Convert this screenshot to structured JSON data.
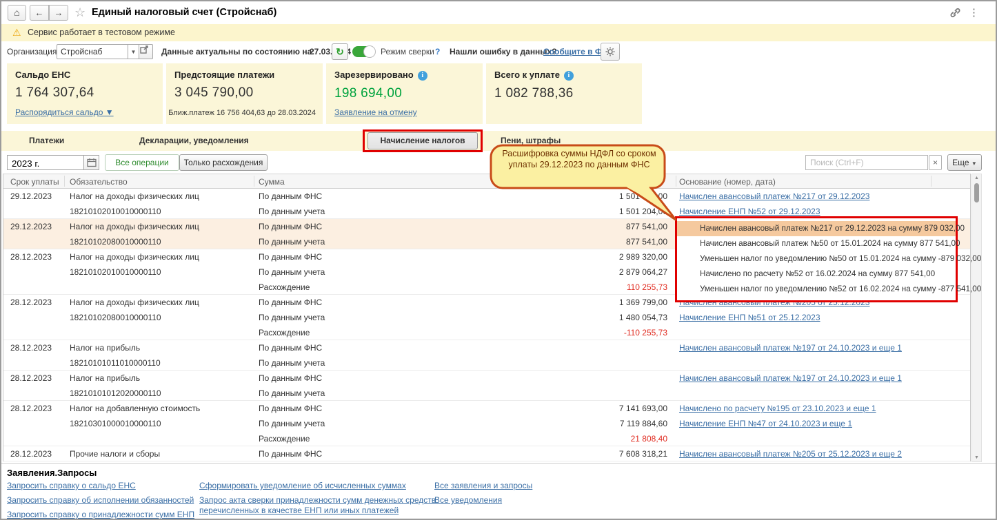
{
  "window": {
    "title": "Единый налоговый счет (Стройснаб)"
  },
  "banner": {
    "text": "Сервис работает в тестовом режиме"
  },
  "toolbar": {
    "org_label": "Организация:",
    "org_value": "Стройснаб",
    "actual_label": "Данные актуальны по состоянию на:",
    "actual_date": "27.03.2024",
    "mode_label": "Режим сверки",
    "mode_help": "?",
    "error_question": "Нашли ошибку в данных?",
    "error_link": "Сообщите в ФНС"
  },
  "cards": [
    {
      "title": "Сальдо ЕНС",
      "value": "1 764 307,64",
      "link": "Распорядиться сальдо ▼"
    },
    {
      "title": "Предстоящие платежи",
      "value": "3 045 790,00",
      "note": "Ближ.платеж 16 756 404,63 до 28.03.2024"
    },
    {
      "title": "Зарезервировано",
      "value": "198 694,00",
      "link": "Заявление на отмену"
    },
    {
      "title": "Всего к уплате",
      "value": "1 082 788,36"
    }
  ],
  "tabs": [
    {
      "label": "Платежи"
    },
    {
      "label": "Декларации, уведомления"
    },
    {
      "label": "Начисление налогов",
      "selected": true
    },
    {
      "label": "Пени, штрафы"
    }
  ],
  "filters": {
    "period_value": "2023 г.",
    "all_ops": "Все операции",
    "only_diff": "Только расхождения",
    "search_placeholder": "Поиск (Ctrl+F)",
    "search_clear": "×",
    "more_label": "Еще"
  },
  "callout": {
    "text": "Расшифровка суммы НДФЛ со сроком уплаты 29.12.2023 по данным ФНС"
  },
  "table": {
    "headers": [
      "Срок уплаты",
      "Обязательство",
      "Сумма",
      "Основание (номер, дата)"
    ],
    "rows": [
      {
        "date": "29.12.2023",
        "name": "Налог на доходы физических лиц",
        "kbk": "18210102010010000110",
        "lines": [
          {
            "label": "По данным ФНС",
            "value": "1 501 204,00"
          },
          {
            "label": "По данным учета",
            "value": "1 501 204,00"
          }
        ],
        "basis": [
          "Начислен авансовый платеж №217 от 29.12.2023",
          "Начисление ЕНП №52 от 29.12.2023"
        ]
      },
      {
        "date": "29.12.2023",
        "name": "Налог на доходы физических лиц",
        "kbk": "18210102080010000110",
        "lines": [
          {
            "label": "По данным ФНС",
            "value": "877 541,00"
          },
          {
            "label": "По данным учета",
            "value": "877 541,00"
          }
        ],
        "basis": []
      },
      {
        "date": "28.12.2023",
        "name": "Налог на доходы физических лиц",
        "kbk": "18210102010010000110",
        "lines": [
          {
            "label": "По данным ФНС",
            "value": "2 989 320,00"
          },
          {
            "label": "По данным учета",
            "value": "2 879 064,27"
          },
          {
            "label": "Расхождение",
            "value": "110 255,73"
          }
        ],
        "basis": []
      },
      {
        "date": "28.12.2023",
        "name": "Налог на доходы физических лиц",
        "kbk": "18210102080010000110",
        "lines": [
          {
            "label": "По данным ФНС",
            "value": "1 369 799,00"
          },
          {
            "label": "По данным учета",
            "value": "1 480 054,73"
          },
          {
            "label": "Расхождение",
            "value": "-110 255,73"
          }
        ],
        "basis": [
          "Начислен авансовый платеж №205 от 25.12.2023",
          "Начисление ЕНП №51 от 25.12.2023"
        ]
      },
      {
        "date": "28.12.2023",
        "name": "Налог на прибыль",
        "kbk": "18210101011010000110",
        "lines": [
          {
            "label": "По данным ФНС",
            "value": ""
          },
          {
            "label": "По данным учета",
            "value": ""
          }
        ],
        "basis": [
          "Начислен авансовый платеж №197 от 24.10.2023 и еще 1"
        ]
      },
      {
        "date": "28.12.2023",
        "name": "Налог на прибыль",
        "kbk": "18210101012020000110",
        "lines": [
          {
            "label": "По данным ФНС",
            "value": ""
          },
          {
            "label": "По данным учета",
            "value": ""
          }
        ],
        "basis": [
          "Начислен авансовый платеж №197 от 24.10.2023 и еще 1"
        ]
      },
      {
        "date": "28.12.2023",
        "name": "Налог на добавленную стоимость",
        "kbk": "18210301000010000110",
        "lines": [
          {
            "label": "По данным ФНС",
            "value": "7 141 693,00"
          },
          {
            "label": "По данным учета",
            "value": "7 119 884,60"
          },
          {
            "label": "Расхождение",
            "value": "21 808,40"
          }
        ],
        "basis": [
          "Начислено по расчету №195 от 23.10.2023 и еще 1",
          "Начисление ЕНП №47 от 24.10.2023 и еще 1"
        ]
      },
      {
        "date": "28.12.2023",
        "name": "Прочие налоги и сборы",
        "kbk": "",
        "lines": [
          {
            "label": "По данным ФНС",
            "value": "7 608 318,21"
          }
        ],
        "basis": [
          "Начислен авансовый платеж №205 от 25.12.2023 и еще 2"
        ]
      }
    ]
  },
  "detail": {
    "rows": [
      "Начислен авансовый платеж №217 от 29.12.2023 на сумму 879 032,00",
      "Начислен авансовый платеж №50 от 15.01.2024 на сумму 877 541,00",
      "Уменьшен налог по уведомлению №50 от 15.01.2024 на сумму -879 032,00",
      "Начислено по расчету №52 от 16.02.2024 на сумму 877 541,00",
      "Уменьшен налог по уведомлению №52 от 16.02.2024 на сумму -877 541,00"
    ]
  },
  "footer": {
    "title": "Заявления.Запросы",
    "col1": [
      "Запросить справку о сальдо ЕНС",
      "Запросить справку об исполнении обязанностей",
      "Запросить справку о принадлежности сумм ЕНП"
    ],
    "col2": [
      "Сформировать уведомление об исчисленных суммах",
      "Запрос акта сверки принадлежности сумм денежных средств перечисленных в качестве ЕНП или иных платежей"
    ],
    "col3": [
      "Все заявления и запросы",
      "Все уведомления"
    ]
  },
  "colors": {
    "reserved_green": "#00a33e",
    "negative_red": "#e02b20",
    "link_blue": "#3a6ea5",
    "row_highlight": "#fcefe1",
    "selection_orange": "#f5c99e",
    "annotation_red": "#e00000",
    "callout_border": "#c84b18",
    "callout_fill": "#fbf0a2",
    "banner_yellow": "#fcf5cd",
    "card_yellow": "#fbf6d8"
  }
}
